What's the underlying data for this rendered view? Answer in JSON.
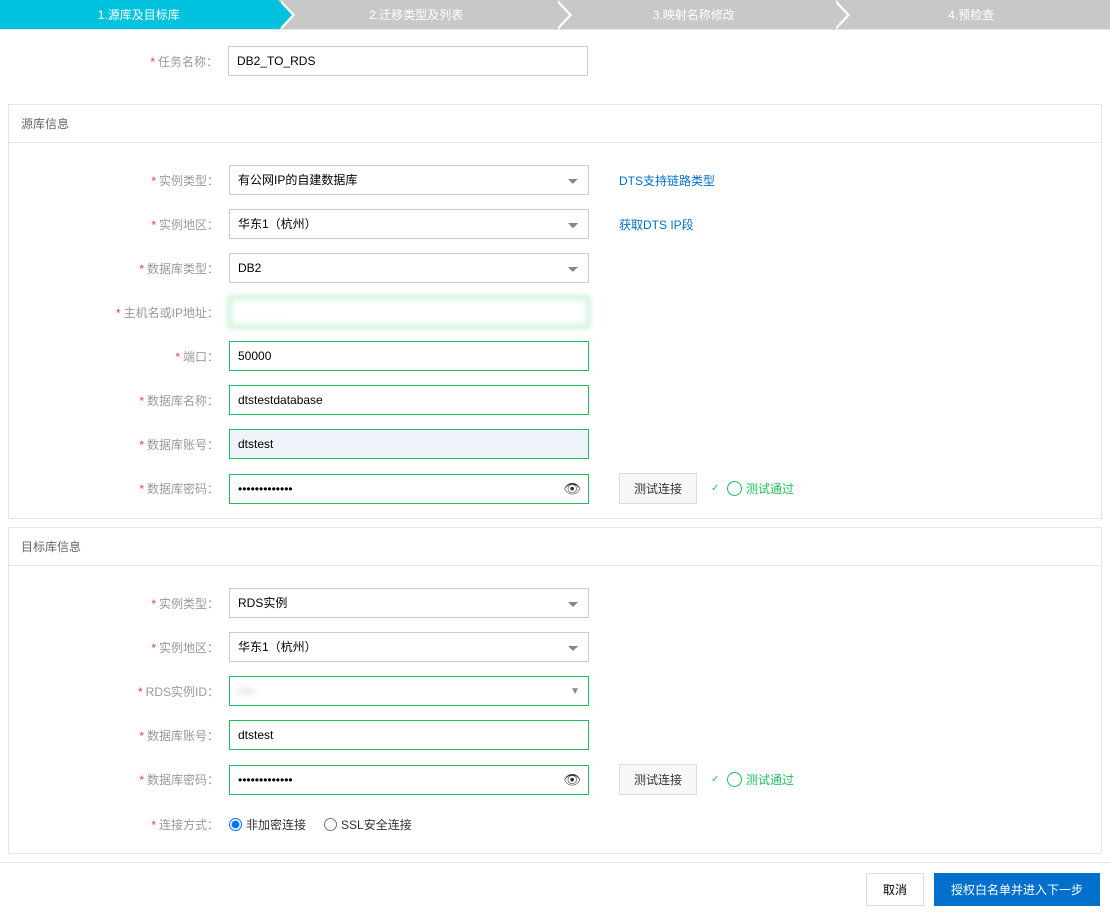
{
  "wizard": {
    "steps": [
      {
        "label": "1.源库及目标库"
      },
      {
        "label": "2.迁移类型及列表"
      },
      {
        "label": "3.映射名称修改"
      },
      {
        "label": "4.预检查"
      }
    ]
  },
  "task_name": {
    "label": "任务名称：",
    "value": "DB2_TO_RDS"
  },
  "source": {
    "header": "源库信息",
    "instance_type": {
      "label": "实例类型：",
      "value": "有公网IP的自建数据库"
    },
    "instance_region": {
      "label": "实例地区：",
      "value": "华东1（杭州）"
    },
    "db_type": {
      "label": "数据库类型：",
      "value": "DB2"
    },
    "host": {
      "label": "主机名或IP地址：",
      "value": "   .  .   .   "
    },
    "port": {
      "label": "端口：",
      "value": "50000"
    },
    "db_name": {
      "label": "数据库名称：",
      "value": "dtstestdatabase"
    },
    "account": {
      "label": "数据库账号：",
      "value": "dtstest"
    },
    "password": {
      "label": "数据库密码：",
      "value": "•••••••••••••"
    },
    "link_support": "DTS支持链路类型",
    "link_ip": "获取DTS IP段"
  },
  "target": {
    "header": "目标库信息",
    "instance_type": {
      "label": "实例类型：",
      "value": "RDS实例"
    },
    "instance_region": {
      "label": "实例地区：",
      "value": "华东1（杭州）"
    },
    "rds_id": {
      "label": "RDS实例ID：",
      "value": "rm-                         "
    },
    "account": {
      "label": "数据库账号：",
      "value": "dtstest"
    },
    "password": {
      "label": "数据库密码：",
      "value": "•••••••••••••"
    },
    "connection_mode": {
      "label": "连接方式：",
      "opt1": "非加密连接",
      "opt2": "SSL安全连接",
      "selected": 0
    }
  },
  "actions": {
    "test_connection": "测试连接",
    "test_pass": "测试通过",
    "cancel": "取消",
    "next": "授权白名单并进入下一步"
  }
}
